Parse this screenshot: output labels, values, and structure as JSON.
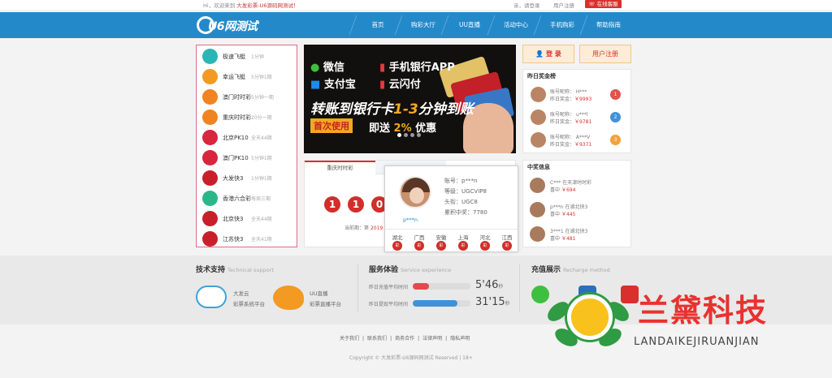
{
  "topbar": {
    "greeting": "Hi，欢迎来到 ",
    "site_name": "大发彩票-U6源码网测试！",
    "login": "亲，请登录",
    "register": "用户注册",
    "service": "在线客服"
  },
  "nav": {
    "logo_text": "U6网测试",
    "items": [
      "首页",
      "购彩大厅",
      "UU直播",
      "活动中心",
      "手机购彩",
      "帮助指南"
    ]
  },
  "lottery_list": [
    {
      "name": "极速飞艇",
      "desc": "1分钟",
      "icon": "speedboat-icon",
      "color": "#2bb6b6"
    },
    {
      "name": "幸运飞艇",
      "desc": "5分钟1期",
      "icon": "boat-icon",
      "color": "#f39a23"
    },
    {
      "name": "澳门时时彩",
      "desc": "5分钟一期",
      "icon": "ssc-icon",
      "color": "#f08322"
    },
    {
      "name": "重庆时时彩",
      "desc": "20分一期",
      "icon": "ssc-icon",
      "color": "#f08322"
    },
    {
      "name": "北京PK10",
      "desc": "全天44期",
      "icon": "pk10-icon",
      "color": "#d7263d"
    },
    {
      "name": "澳门PK10",
      "desc": "5分钟1期",
      "icon": "pk10-icon",
      "color": "#d7263d"
    },
    {
      "name": "大发快3",
      "desc": "1分钟1期",
      "icon": "k3-icon",
      "color": "#c8202a"
    },
    {
      "name": "香港六合彩",
      "desc": "每周三期",
      "icon": "lhc-icon",
      "color": "#2bb68a"
    },
    {
      "name": "北京快3",
      "desc": "全天44期",
      "icon": "k3-icon",
      "color": "#c8202a"
    },
    {
      "name": "江苏快3",
      "desc": "全天41期",
      "icon": "k3-icon",
      "color": "#c8202a"
    }
  ],
  "banner": {
    "wechat": "微信",
    "alipay": "支付宝",
    "bank_app": "手机银行APP",
    "cloud_pay": "云闪付",
    "headline_a": "转账到银行卡",
    "headline_b": "1-3",
    "headline_c": "分钟到账",
    "first_use": "首次使用",
    "send_a": "即送",
    "send_b": "2%",
    "send_c": "优惠"
  },
  "draw": {
    "tab1": "重庆时时彩",
    "balls": [
      "1",
      "1",
      "0"
    ],
    "prev_label": "当前期：第",
    "prev_number": "2019"
  },
  "popup": {
    "username": "p***n",
    "account": "账号：p***n",
    "level": "等级：UGCVIP8",
    "title": "头衔：UGC8",
    "total": "累积中奖：7780",
    "provinces": [
      "湖北",
      "广西",
      "安徽",
      "上海",
      "河北",
      "江西"
    ],
    "ball_label": "彩"
  },
  "auth": {
    "login": "登 录",
    "register": "用户注册"
  },
  "winners": {
    "heading": "昨日奖金榜",
    "rows": [
      {
        "nick": "账号昵称： H***",
        "amount_label": "昨日奖金：",
        "amount": "￥9993",
        "rank": "1",
        "rank_color": "#e0524a"
      },
      {
        "nick": "账号昵称： u***l",
        "amount_label": "昨日奖金：",
        "amount": "￥9781",
        "rank": "2",
        "rank_color": "#3f92d8"
      },
      {
        "nick": "账号昵称： A***V",
        "amount_label": "昨日奖金：",
        "amount": "￥9371",
        "rank": "3",
        "rank_color": "#f1a23a"
      }
    ]
  },
  "news": {
    "heading": "中奖信息",
    "rows": [
      {
        "l1": "C*** 在天津时时彩",
        "l2a": "喜中",
        "amount": "￥694"
      },
      {
        "l1": "p***n 在湖北快3",
        "l2a": "喜中",
        "amount": "￥445"
      },
      {
        "l1": "3***1 在湖北快3",
        "l2a": "喜中",
        "amount": "￥481"
      }
    ]
  },
  "support": {
    "heading": "技术支持",
    "heading_en": "Technical support",
    "item1_a": "大发云",
    "item1_b": "彩票系统平台",
    "item2_a": "UU直播",
    "item2_b": "彩票直播平台"
  },
  "service": {
    "heading": "服务体验",
    "heading_en": "Service experience",
    "row1_label": "昨日充值平均时间",
    "row1_value": "5'46",
    "row1_unit": "秒",
    "row1_fill": 0.28,
    "row2_label": "昨日提现平均时间",
    "row2_value": "31'15",
    "row2_unit": "秒",
    "row2_fill": 0.78
  },
  "recharge": {
    "heading": "充值展示",
    "heading_en": "Recharge method"
  },
  "footer": {
    "links": [
      "关于我们",
      "|",
      "联系我们",
      "|",
      "商务合作",
      "|",
      "法律声明",
      "|",
      "隐私声明"
    ],
    "copyright": "Copyright © 大发彩票-U6源码网测试 Reserved | 18+"
  },
  "watermark": {
    "title": "兰黛科技",
    "subtitle": "LANDAIKEJIRUANJIAN"
  }
}
